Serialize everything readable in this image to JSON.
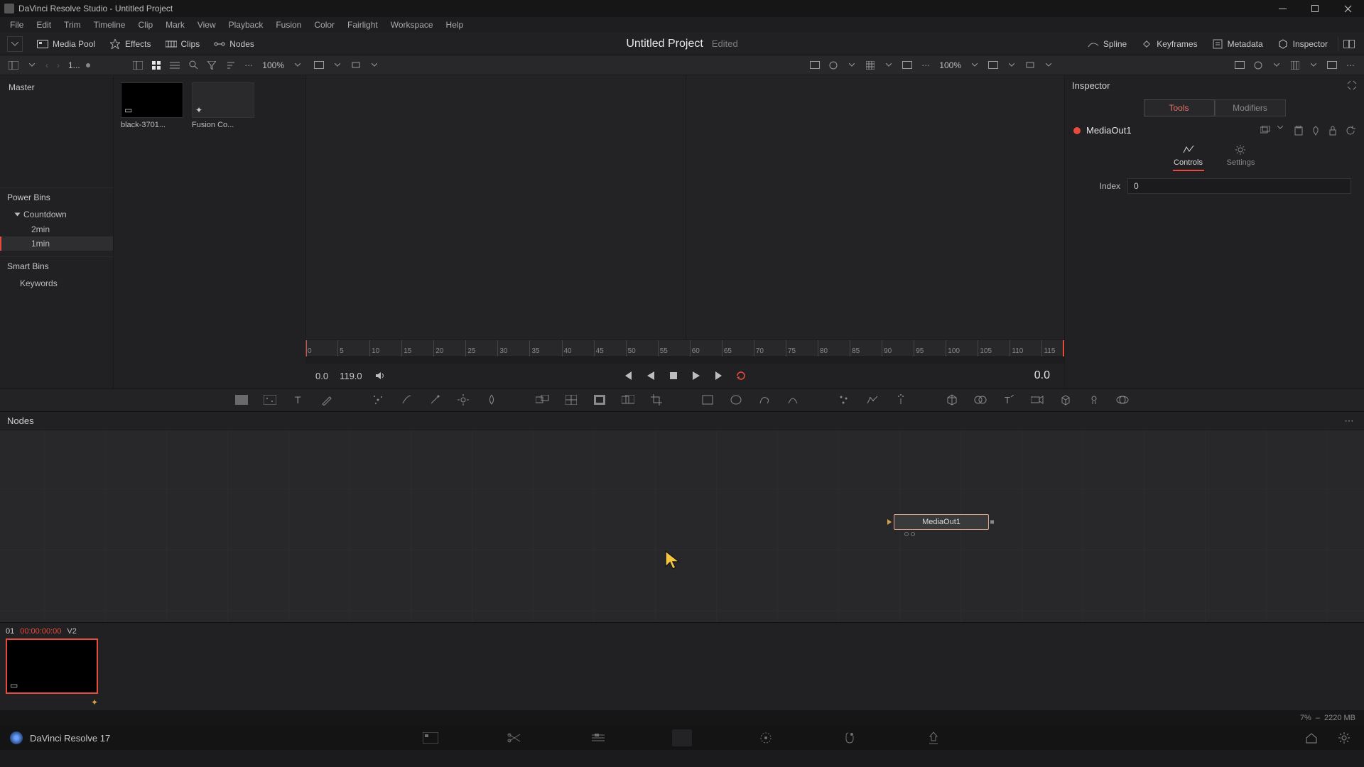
{
  "window": {
    "title": "DaVinci Resolve Studio - Untitled Project"
  },
  "menu": [
    "File",
    "Edit",
    "Trim",
    "Timeline",
    "Clip",
    "Mark",
    "View",
    "Playback",
    "Fusion",
    "Color",
    "Fairlight",
    "Workspace",
    "Help"
  ],
  "toolbar": {
    "media_pool": "Media Pool",
    "effects": "Effects",
    "clips": "Clips",
    "nodes": "Nodes",
    "spline": "Spline",
    "keyframes": "Keyframes",
    "metadata": "Metadata",
    "inspector": "Inspector"
  },
  "project": {
    "name": "Untitled Project",
    "status": "Edited"
  },
  "sec": {
    "sort_label": "1...",
    "zoom_left": "100%",
    "zoom_right": "100%"
  },
  "media_pool": {
    "master": "Master",
    "power_bins": "Power Bins",
    "countdown": "Countdown",
    "items": [
      "2min",
      "1min"
    ],
    "smart_bins": "Smart Bins",
    "keywords": "Keywords",
    "clips": [
      {
        "label": "black-3701..."
      },
      {
        "label": "Fusion Co..."
      }
    ]
  },
  "ruler": {
    "ticks": [
      "0",
      "5",
      "10",
      "15",
      "20",
      "25",
      "30",
      "35",
      "40",
      "45",
      "50",
      "55",
      "60",
      "65",
      "70",
      "75",
      "80",
      "85",
      "90",
      "95",
      "100",
      "105",
      "110",
      "115"
    ]
  },
  "transport": {
    "in": "0.0",
    "out": "119.0",
    "current": "0.0"
  },
  "nodes_panel": {
    "title": "Nodes",
    "node_name": "MediaOut1"
  },
  "inspector": {
    "title": "Inspector",
    "tabs": {
      "tools": "Tools",
      "modifiers": "Modifiers"
    },
    "node": "MediaOut1",
    "subtabs": {
      "controls": "Controls",
      "settings": "Settings"
    },
    "index_label": "Index",
    "index_value": "0"
  },
  "clip": {
    "num": "01",
    "tc": "00:00:00:00",
    "track": "V2"
  },
  "status": {
    "gpu": "7%",
    "mem": "2220 MB"
  },
  "footer": {
    "app": "DaVinci Resolve 17"
  }
}
